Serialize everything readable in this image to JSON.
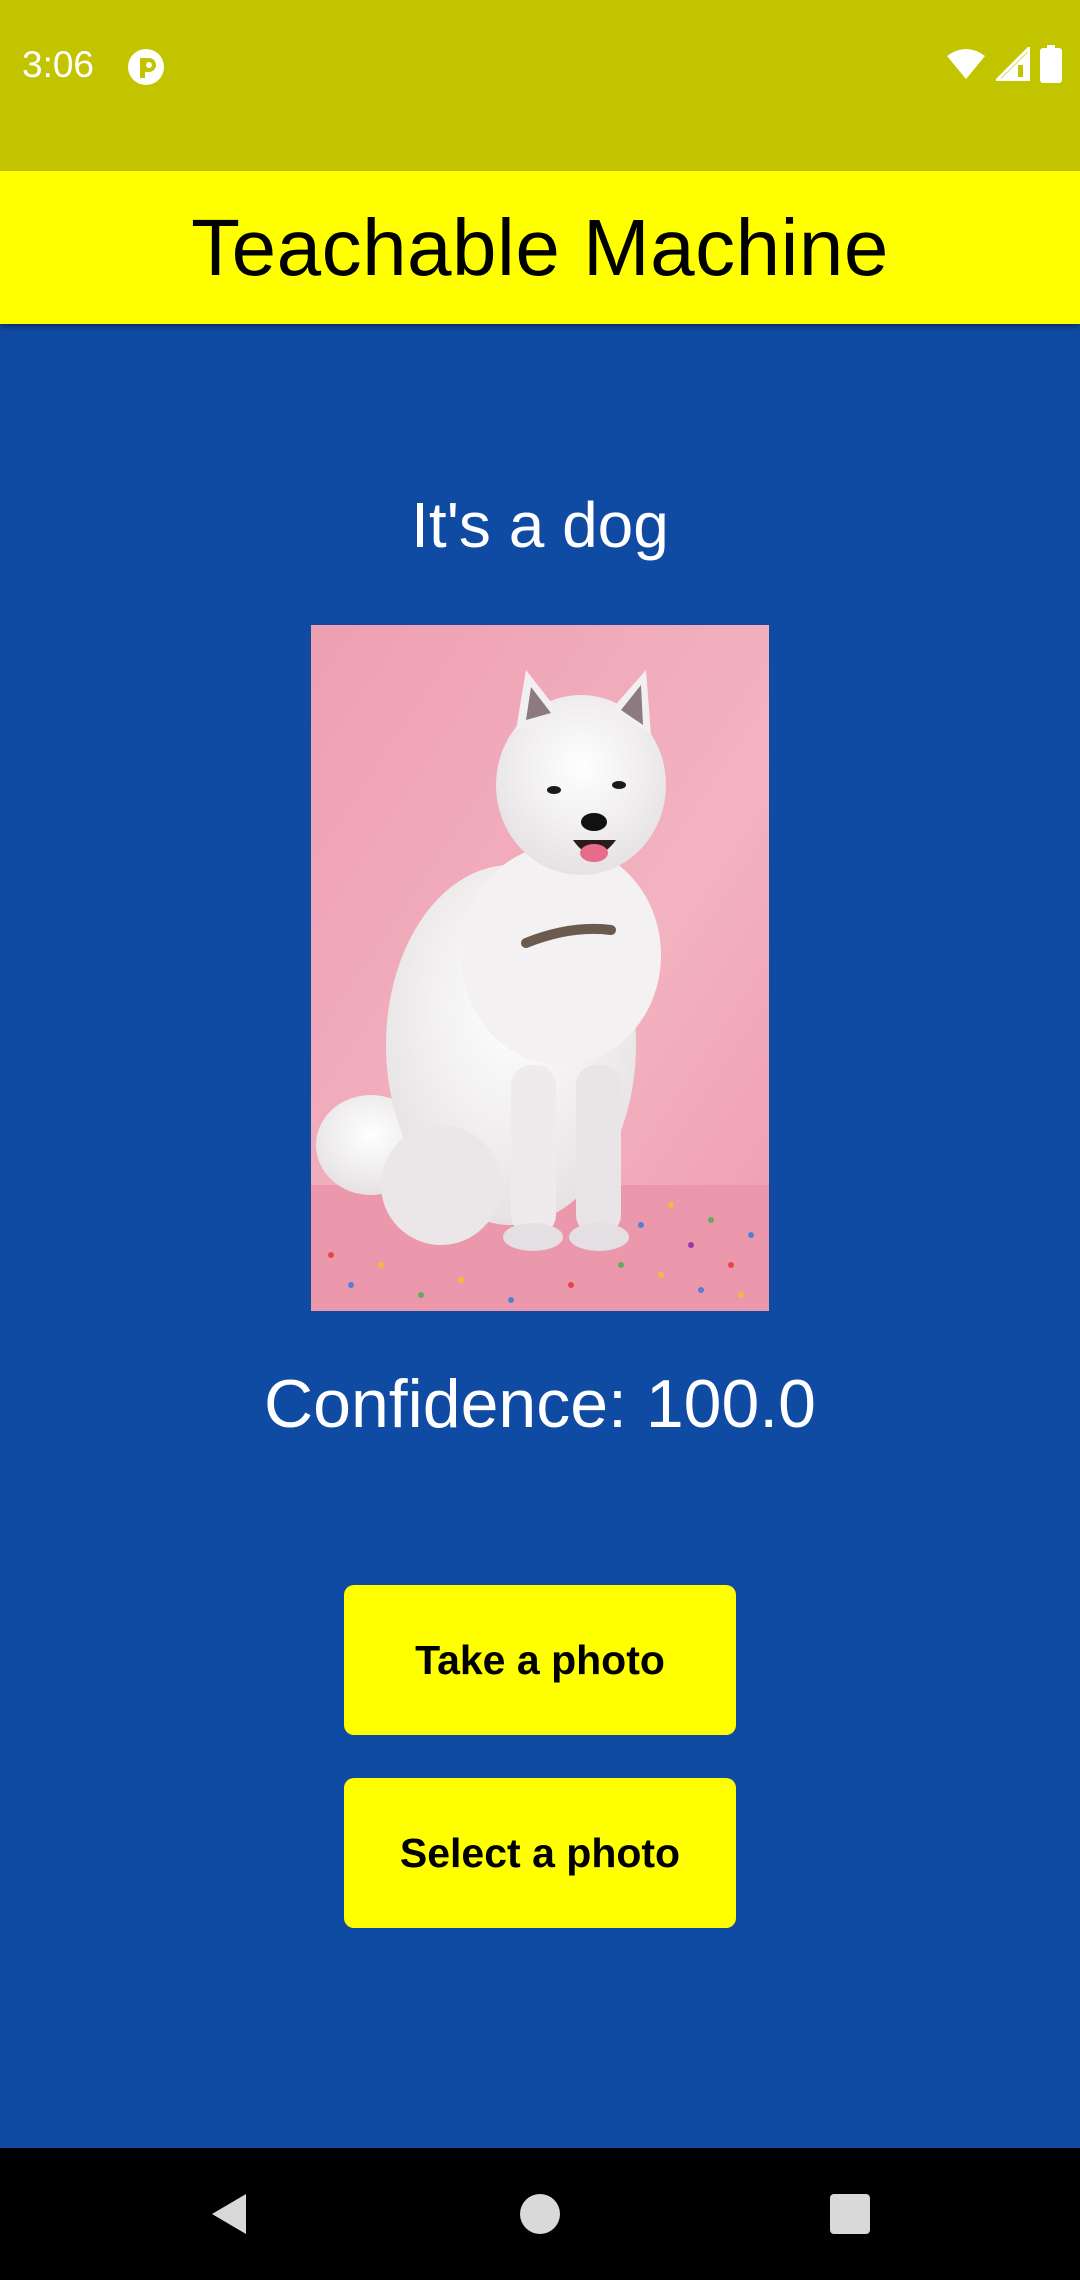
{
  "status_bar": {
    "time": "3:06",
    "icons": [
      "app-notification-icon",
      "wifi-icon",
      "cellular-signal-icon",
      "battery-icon"
    ],
    "background": "#c3c400"
  },
  "app_bar": {
    "title": "Teachable Machine",
    "background": "#ffff00"
  },
  "main": {
    "background": "#0f4aa3",
    "result_text": "It's a dog",
    "confidence_text": "Confidence: 100.0",
    "photo_subject": "white-samoyed-dog-on-pink-background"
  },
  "buttons": {
    "take_photo_label": "Take a photo",
    "select_photo_label": "Select a photo",
    "background": "#ffff00"
  },
  "nav_bar": {
    "icons": [
      "back-icon",
      "home-icon",
      "recents-icon"
    ]
  }
}
